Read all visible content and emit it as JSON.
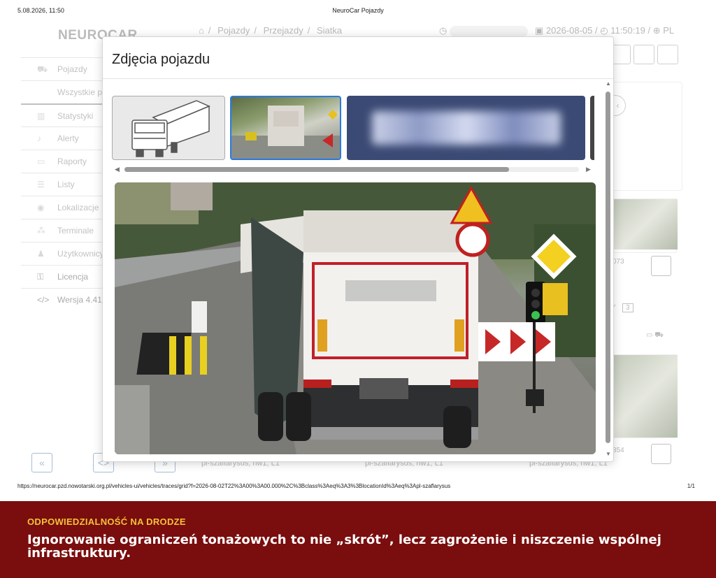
{
  "print": {
    "datetime": "5.08.2026, 11:50",
    "title": "NeuroCar Pojazdy",
    "url": "https://neurocar.pzd.nowotarski.org.pl/vehicles-ui/vehicles/traces/grid?f=2026-08-02T22%3A00%3A00.000%2C%3Bclass%3Aeq%3A3%3BlocationId%3Aeq%3Apl-szaflarysus",
    "page_count": "1/1"
  },
  "app": {
    "logo": "NEUROCAR",
    "breadcrumb": [
      "Pojazdy",
      "Przejazdy",
      "Siatka"
    ],
    "date": "2026-08-05",
    "time": "11:50:19",
    "lang": "PL"
  },
  "sidebar": {
    "items": [
      {
        "label": "Pojazdy",
        "icon": "car-icon"
      },
      {
        "label": "Wszystkie pojazdy",
        "icon": ""
      },
      {
        "label": "Statystyki",
        "icon": "chart-icon"
      },
      {
        "label": "Alerty",
        "icon": "bell-icon"
      },
      {
        "label": "Raporty",
        "icon": "inbox-icon"
      },
      {
        "label": "Listy",
        "icon": "list-icon"
      },
      {
        "label": "Lokalizacje",
        "icon": "pin-icon"
      },
      {
        "label": "Terminale",
        "icon": "network-icon"
      },
      {
        "label": "Użytkownicy",
        "icon": "user-icon"
      },
      {
        "label": "Licencja",
        "icon": "key-icon"
      },
      {
        "label": "Wersja 4.41",
        "icon": "code-icon"
      }
    ]
  },
  "pager": {
    "first": "«",
    "code": "<>",
    "next": "»"
  },
  "grid": {
    "labels": [
      "pl-szaflarysus, nw1, L1",
      "pl-szaflarysus, nw1, L1",
      "pl-szaflarysus, nw1, L1"
    ],
    "card1_id": "073",
    "card1_count": "3",
    "card2_id": "354"
  },
  "modal": {
    "title": "Zdjęcia pojazdu",
    "thumbnails": [
      "vehicle-class-icon",
      "photo-thumbnail",
      "plate-thumbnail",
      "photo-thumbnail"
    ]
  },
  "banner": {
    "kicker": "ODPOWIEDZIALNOŚĆ NA DRODZE",
    "text": "Ignorowanie ograniczeń tonażowych to nie „skrót”, lecz zagrożenie i niszczenie wspólnej infrastruktury."
  },
  "colors": {
    "banner_bg": "#7a0d0d",
    "banner_kicker": "#f2c33a",
    "accent": "#2a7ae2"
  }
}
